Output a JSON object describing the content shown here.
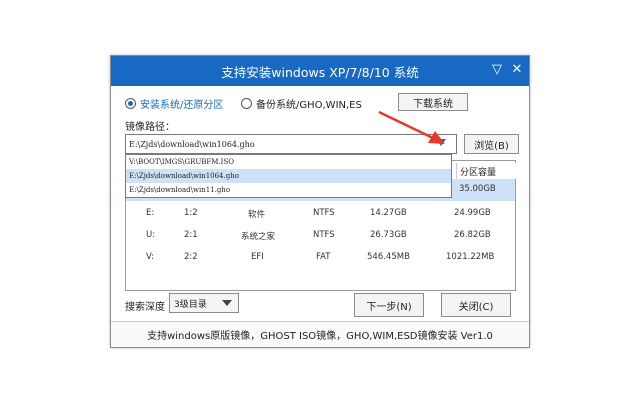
{
  "window": {
    "title": "支持安装windows XP/7/8/10 系统",
    "minimize": "▽",
    "close": "✕"
  },
  "modes": {
    "option1": "安装系统/还原分区",
    "option2": "备份系统/GHO,WIN,ES",
    "selected": "安装系统/还原分区"
  },
  "buttons": {
    "download": "下载系统",
    "browse": "浏览(B)",
    "next": "下一步(N)",
    "close": "关闭(C)"
  },
  "image_path": {
    "label": "镜像路径：",
    "value": "E:\\Zjds\\download\\win1064.gho",
    "options": [
      "V:\\BOOT\\IMGS\\GRUBFM.ISO",
      "E:\\Zjds\\download\\win1064.gho",
      "E:\\Zjds\\download\\win11.gho"
    ],
    "selected_index": 1
  },
  "partitions": {
    "header_capacity": "分区容量",
    "rows": [
      {
        "drive": "",
        "num": "",
        "label": "",
        "fs": "",
        "free": "",
        "capacity": "35.00GB"
      },
      {
        "drive": "E:",
        "num": "1:2",
        "label": "软件",
        "fs": "NTFS",
        "free": "14.27GB",
        "capacity": "24.99GB"
      },
      {
        "drive": "U:",
        "num": "2:1",
        "label": "系统之家",
        "fs": "NTFS",
        "free": "26.73GB",
        "capacity": "26.82GB"
      },
      {
        "drive": "V:",
        "num": "2:2",
        "label": "EFI",
        "fs": "FAT",
        "free": "546.45MB",
        "capacity": "1021.22MB"
      }
    ]
  },
  "search_depth": {
    "label": "搜索深度",
    "value": "3级目录"
  },
  "status_bar": "支持windows原版镜像，GHOST ISO镜像，GHO,WIM,ESD镜像安装 Ver1.0",
  "colors": {
    "accent": "#1769c4",
    "highlight": "#cde1f7",
    "annotation_arrow": "#e53a2a"
  }
}
